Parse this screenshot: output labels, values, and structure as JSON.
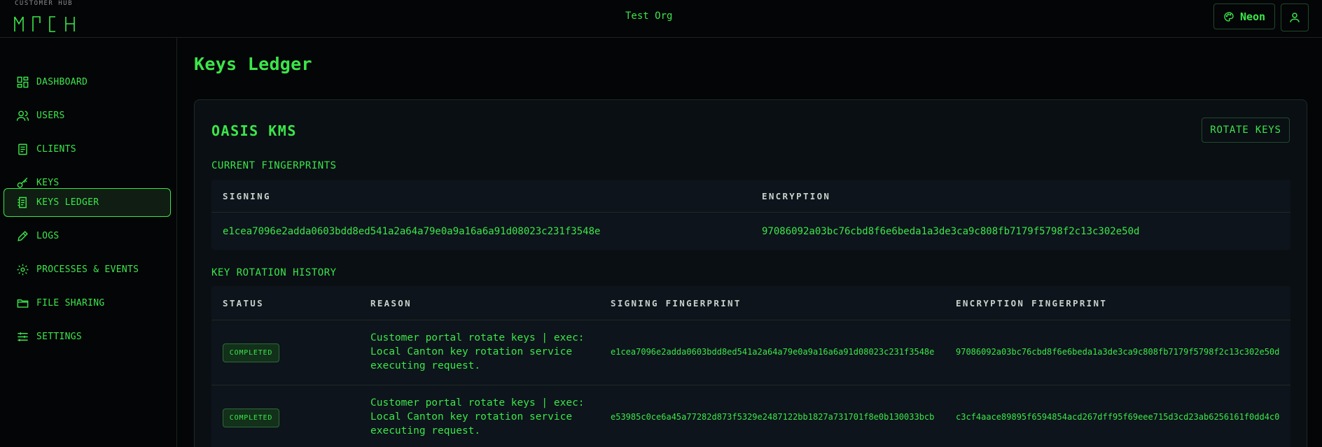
{
  "header": {
    "brand_small": "CUSTOMER HUB",
    "org_name": "Test Org",
    "theme_label": "Neon"
  },
  "sidebar": {
    "items": [
      {
        "label": "DASHBOARD",
        "icon": "dashboard-icon"
      },
      {
        "label": "USERS",
        "icon": "users-icon"
      },
      {
        "label": "CLIENTS",
        "icon": "clients-icon"
      },
      {
        "label": "KEYS",
        "icon": "key-icon"
      },
      {
        "label": "KEYS LEDGER",
        "icon": "ledger-icon",
        "active": true
      },
      {
        "label": "LOGS",
        "icon": "pencil-icon"
      },
      {
        "label": "PROCESSES & EVENTS",
        "icon": "gear-icon"
      },
      {
        "label": "FILE SHARING",
        "icon": "folder-icon"
      },
      {
        "label": "SETTINGS",
        "icon": "sliders-icon"
      }
    ]
  },
  "main": {
    "page_title": "Keys Ledger",
    "card": {
      "title": "OASIS KMS",
      "rotate_label": "ROTATE KEYS",
      "current": {
        "title": "CURRENT FINGERPRINTS",
        "headers": [
          "SIGNING",
          "ENCRYPTION"
        ],
        "signing": "e1cea7096e2adda0603bdd8ed541a2a64a79e0a9a16a6a91d08023c231f3548e",
        "encryption": "97086092a03bc76cbd8f6e6beda1a3de3ca9c808fb7179f5798f2c13c302e50d"
      },
      "history": {
        "title": "KEY ROTATION HISTORY",
        "headers": [
          "STATUS",
          "REASON",
          "SIGNING FINGERPRINT",
          "ENCRYPTION FINGERPRINT"
        ],
        "rows": [
          {
            "status": "COMPLETED",
            "reason": "Customer portal rotate keys | exec: Local Canton key rotation service executing request.",
            "signing": "e1cea7096e2adda0603bdd8ed541a2a64a79e0a9a16a6a91d08023c231f3548e",
            "encryption": "97086092a03bc76cbd8f6e6beda1a3de3ca9c808fb7179f5798f2c13c302e50d"
          },
          {
            "status": "COMPLETED",
            "reason": "Customer portal rotate keys | exec: Local Canton key rotation service executing request.",
            "signing": "e53985c0ce6a45a77282d873f5329e2487122bb1827a731701f8e0b130033bcb",
            "encryption": "c3cf4aace89895f6594854acd267dff95f69eee715d3cd23ab6256161f0dd4c0"
          }
        ]
      }
    }
  },
  "colors": {
    "accent": "#3be64a",
    "background": "#040507",
    "card": "#0a0f14"
  }
}
